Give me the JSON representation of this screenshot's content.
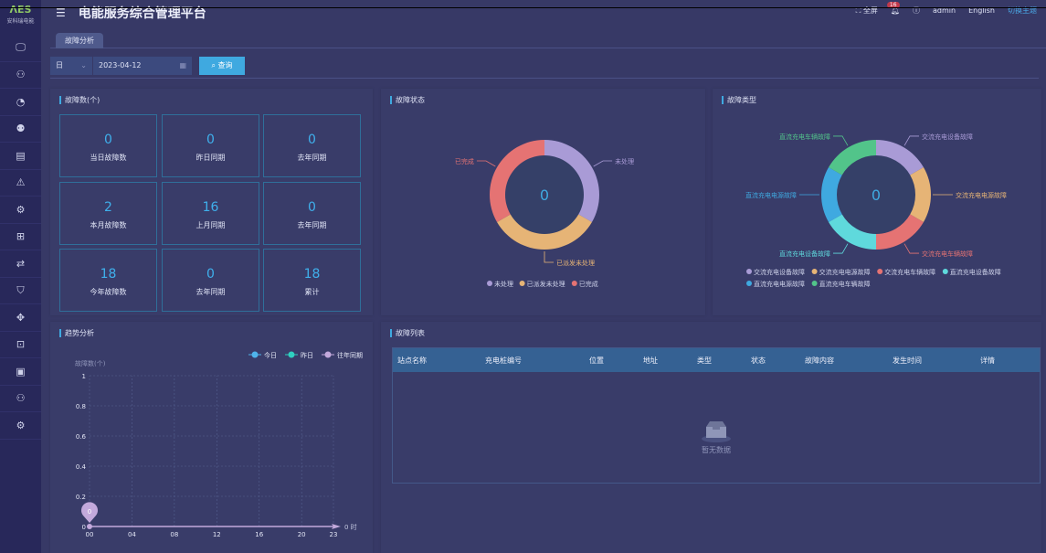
{
  "app": {
    "logo_text": "安科瑞电能",
    "title": "电能服务综合管理平台"
  },
  "header": {
    "fullscreen": "全屏",
    "notifications": "16",
    "user": "admin",
    "language": "English",
    "theme": "切换主题"
  },
  "sidebar": {
    "icons": [
      "monitor-icon",
      "network-icon",
      "pie-chart-icon",
      "users-icon",
      "document-icon",
      "warning-icon",
      "gear-alert-icon",
      "gift-icon",
      "transfer-icon",
      "shield-icon",
      "device-icon",
      "meter-icon",
      "server-icon",
      "topology-icon",
      "settings-icon"
    ]
  },
  "tabs": [
    {
      "label": "故障分析",
      "active": true
    }
  ],
  "query": {
    "period": "日",
    "date": "2023-04-12",
    "button": "查询"
  },
  "fault_count": {
    "title": "故障数(个)",
    "cards": [
      {
        "value": "0",
        "label": "当日故障数"
      },
      {
        "value": "0",
        "label": "昨日同期"
      },
      {
        "value": "0",
        "label": "去年同期"
      },
      {
        "value": "2",
        "label": "本月故障数"
      },
      {
        "value": "16",
        "label": "上月同期"
      },
      {
        "value": "0",
        "label": "去年同期"
      },
      {
        "value": "18",
        "label": "今年故障数"
      },
      {
        "value": "0",
        "label": "去年同期"
      },
      {
        "value": "18",
        "label": "累计"
      }
    ]
  },
  "chart_data": [
    {
      "type": "pie",
      "title": "故障状态",
      "center_label": "0",
      "legend_position": "bottom",
      "categories": [
        "未处理",
        "已派发未处理",
        "已完成"
      ],
      "values": [
        0,
        0,
        0
      ],
      "colors": [
        "#a99bd6",
        "#e6b476",
        "#e57373"
      ]
    },
    {
      "type": "pie",
      "title": "故障类型",
      "center_label": "0",
      "legend_position": "bottom",
      "categories": [
        "交流充电设备故障",
        "交流充电电源故障",
        "交流充电车辆故障",
        "直流充电设备故障",
        "直流充电电源故障",
        "直流充电车辆故障"
      ],
      "values": [
        0,
        0,
        0,
        0,
        0,
        0
      ],
      "colors": [
        "#a99bd6",
        "#e6b476",
        "#e57373",
        "#5fd9dc",
        "#3fa9e0",
        "#52c48a"
      ]
    },
    {
      "type": "line",
      "title": "趋势分析",
      "ylabel": "故障数(个)",
      "xunit": "时",
      "legend_position": "top-right",
      "grid": true,
      "x": [
        "00",
        "01",
        "02",
        "03",
        "04",
        "05",
        "06",
        "07",
        "08",
        "09",
        "10",
        "11",
        "12",
        "13",
        "14",
        "15",
        "16",
        "17",
        "18",
        "19",
        "20",
        "21",
        "22",
        "23"
      ],
      "xticks": [
        "00",
        "04",
        "08",
        "12",
        "16",
        "20",
        "23"
      ],
      "yticks": [
        "0",
        "0.2",
        "0.4",
        "0.6",
        "0.8",
        "1"
      ],
      "ylim": [
        0,
        1
      ],
      "series": [
        {
          "name": "今日",
          "color": "#4fb3ea",
          "values": []
        },
        {
          "name": "昨日",
          "color": "#2fd0c0",
          "values": []
        },
        {
          "name": "往年同期",
          "color": "#c3a9dc",
          "values": [
            0
          ]
        }
      ],
      "marker_label": "0",
      "end_label": "0"
    }
  ],
  "fault_list": {
    "title": "故障列表",
    "columns": [
      "站点名称",
      "充电桩编号",
      "位置",
      "地址",
      "类型",
      "状态",
      "故障内容",
      "发生时间",
      "详情"
    ],
    "rows": [],
    "empty_text": "暂无数据"
  }
}
